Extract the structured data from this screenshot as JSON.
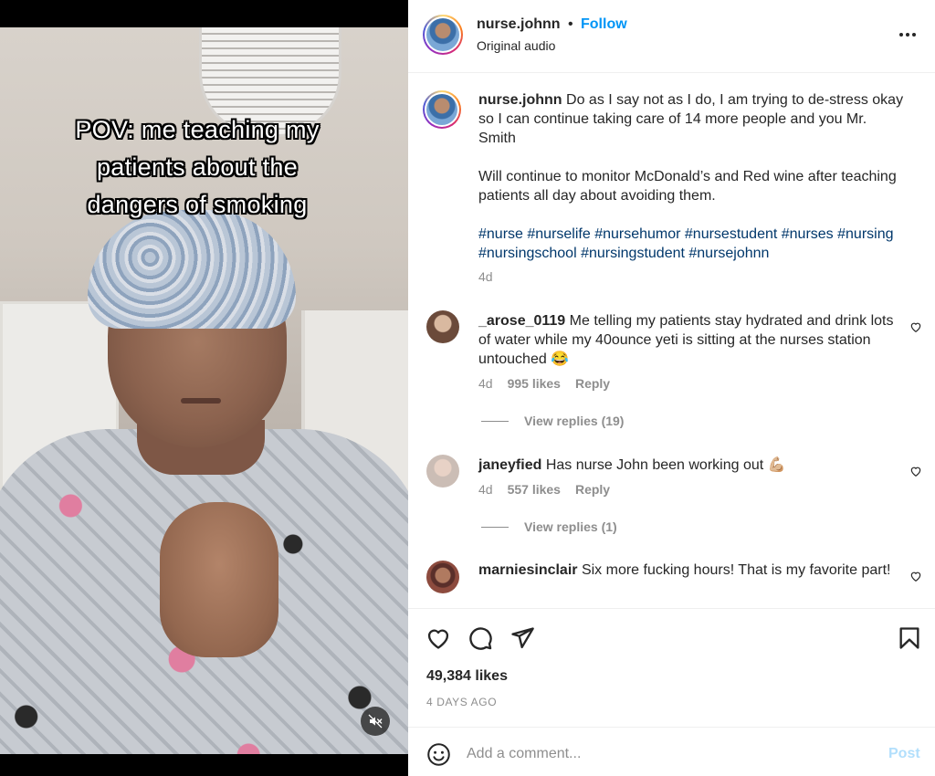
{
  "video": {
    "overlay_lines": [
      "POV: me teaching my",
      "patients about the",
      "dangers of smoking"
    ],
    "mute_icon": "speaker-muted-icon"
  },
  "header": {
    "username": "nurse.johnn",
    "separator": "•",
    "follow_label": "Follow",
    "audio_label": "Original audio",
    "more_icon": "more-options-icon"
  },
  "caption": {
    "username": "nurse.johnn",
    "text_1": "Do as I say not as I do, I am trying to de-stress okay so I can continue taking care of 14 more people and you Mr. Smith",
    "text_2": "Will continue to monitor McDonald’s and Red wine after teaching patients all day about avoiding them.",
    "hashtags": "#nurse #nurselife #nursehumor #nursestudent #nurses #nursing #nursingschool #nursingstudent #nursejohnn",
    "age": "4d"
  },
  "comments": [
    {
      "username": "_arose_0119",
      "text": "Me telling my patients stay hydrated and drink lots of water while my 40ounce yeti is sitting at the nurses station untouched 😂",
      "age": "4d",
      "likes": "995 likes",
      "reply_label": "Reply",
      "view_replies": "View replies (19)"
    },
    {
      "username": "janeyfied",
      "text": "Has nurse John been working out 💪🏼",
      "age": "4d",
      "likes": "557 likes",
      "reply_label": "Reply",
      "view_replies": "View replies (1)"
    },
    {
      "username": "marniesinclair",
      "text": "Six more fucking hours! That is my favorite part!"
    }
  ],
  "actions": {
    "likes": "49,384 likes",
    "date": "4 DAYS AGO",
    "icons": [
      "heart-icon",
      "comment-icon",
      "share-icon",
      "bookmark-icon"
    ]
  },
  "add_comment": {
    "placeholder": "Add a comment...",
    "post_label": "Post",
    "emoji_icon": "smiley-face-icon"
  },
  "colors": {
    "accent_blue": "#0095f6",
    "hashtag_blue": "#00376b",
    "muted_gray": "#8e8e8e",
    "post_disabled": "#b2dffc"
  }
}
